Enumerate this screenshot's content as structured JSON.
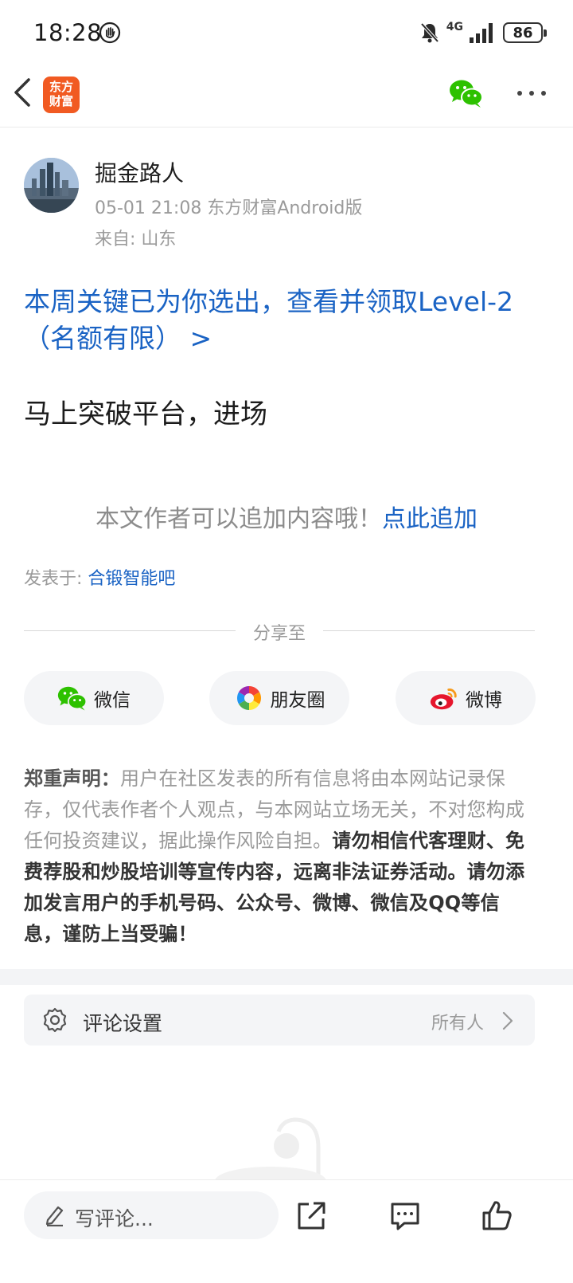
{
  "status_bar": {
    "time": "18:28",
    "network": "4G",
    "battery": "86"
  },
  "nav": {
    "logo_line1": "东方",
    "logo_line2": "财富",
    "share_icon": "wechat-icon",
    "more_icon": "more-dots-icon"
  },
  "post": {
    "author": "掘金路人",
    "meta": "05-01 21:08 东方财富Android版",
    "location": "来自: 山东",
    "promo_link": "本周关键已为你选出，查看并领取Level-2（名额有限） >",
    "body": "马上突破平台，进场",
    "append_prompt": "本文作者可以追加内容哦！",
    "append_link": "点此追加",
    "posted_in_label": "发表于:",
    "posted_in_bar": "合锻智能吧"
  },
  "share": {
    "label": "分享至",
    "buttons": [
      {
        "label": "微信",
        "icon": "wechat-icon"
      },
      {
        "label": "朋友圈",
        "icon": "moments-icon"
      },
      {
        "label": "微博",
        "icon": "weibo-icon"
      }
    ]
  },
  "disclaimer": {
    "title": "郑重声明：",
    "text_normal": "用户在社区发表的所有信息将由本网站记录保存，仅代表作者个人观点，与本网站立场无关，不对您构成任何投资建议，据此操作风险自担。",
    "text_bold": "请勿相信代客理财、免费荐股和炒股培训等宣传内容，远离非法证券活动。请勿添加发言用户的手机号码、公众号、微博、微信及QQ等信息，谨防上当受骗！"
  },
  "comment_settings": {
    "label": "评论设置",
    "value": "所有人"
  },
  "bottom_bar": {
    "comment_placeholder": "写评论..."
  },
  "colors": {
    "link_blue": "#1a63c4",
    "brand_orange": "#f15a22",
    "wechat_green": "#2dc100"
  }
}
